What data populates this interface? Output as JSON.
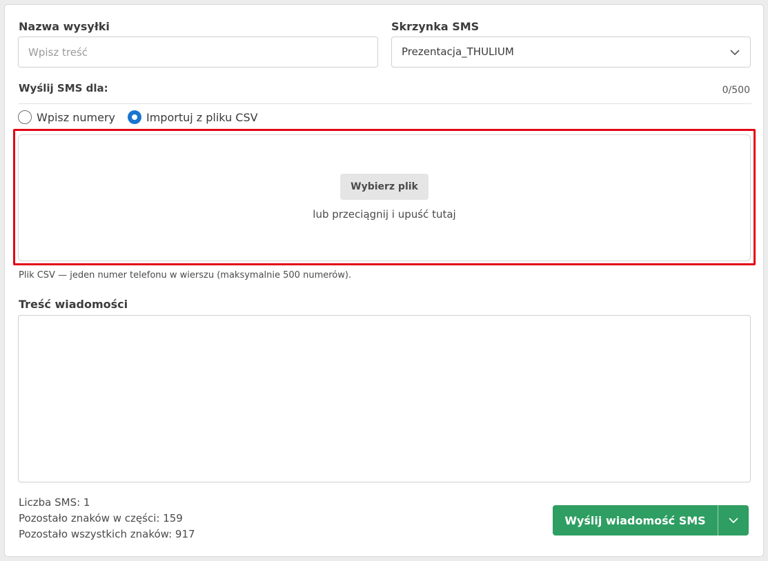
{
  "colors": {
    "accent": "#1a75cf",
    "send_button": "#2e9e62",
    "highlight_border": "#e30613"
  },
  "form": {
    "name": {
      "label": "Nazwa wysyłki",
      "placeholder": "Wpisz treść",
      "value": ""
    },
    "sms_box": {
      "label": "Skrzynka SMS",
      "selected": "Prezentacja_THULIUM",
      "icon": "chevron-down-icon"
    },
    "recipients": {
      "label": "Wyślij SMS dla:",
      "counter": "0/500",
      "options": [
        {
          "label": "Wpisz numery",
          "selected": false
        },
        {
          "label": "Importuj z pliku CSV",
          "selected": true
        }
      ]
    },
    "upload": {
      "button_label": "Wybierz plik",
      "drop_text": "lub przeciągnij i upuść tutaj",
      "hint": "Plik CSV — jeden numer telefonu w wierszu (maksymalnie 500 numerów)."
    },
    "message": {
      "label": "Treść wiadomości",
      "value": ""
    }
  },
  "stats": {
    "sms_count": "Liczba SMS: 1",
    "chars_left_part": "Pozostało znaków w części: 159",
    "chars_left_total": "Pozostało wszystkich znaków: 917"
  },
  "actions": {
    "send_label": "Wyślij wiadomość SMS",
    "send_dropdown_icon": "chevron-down-icon"
  }
}
